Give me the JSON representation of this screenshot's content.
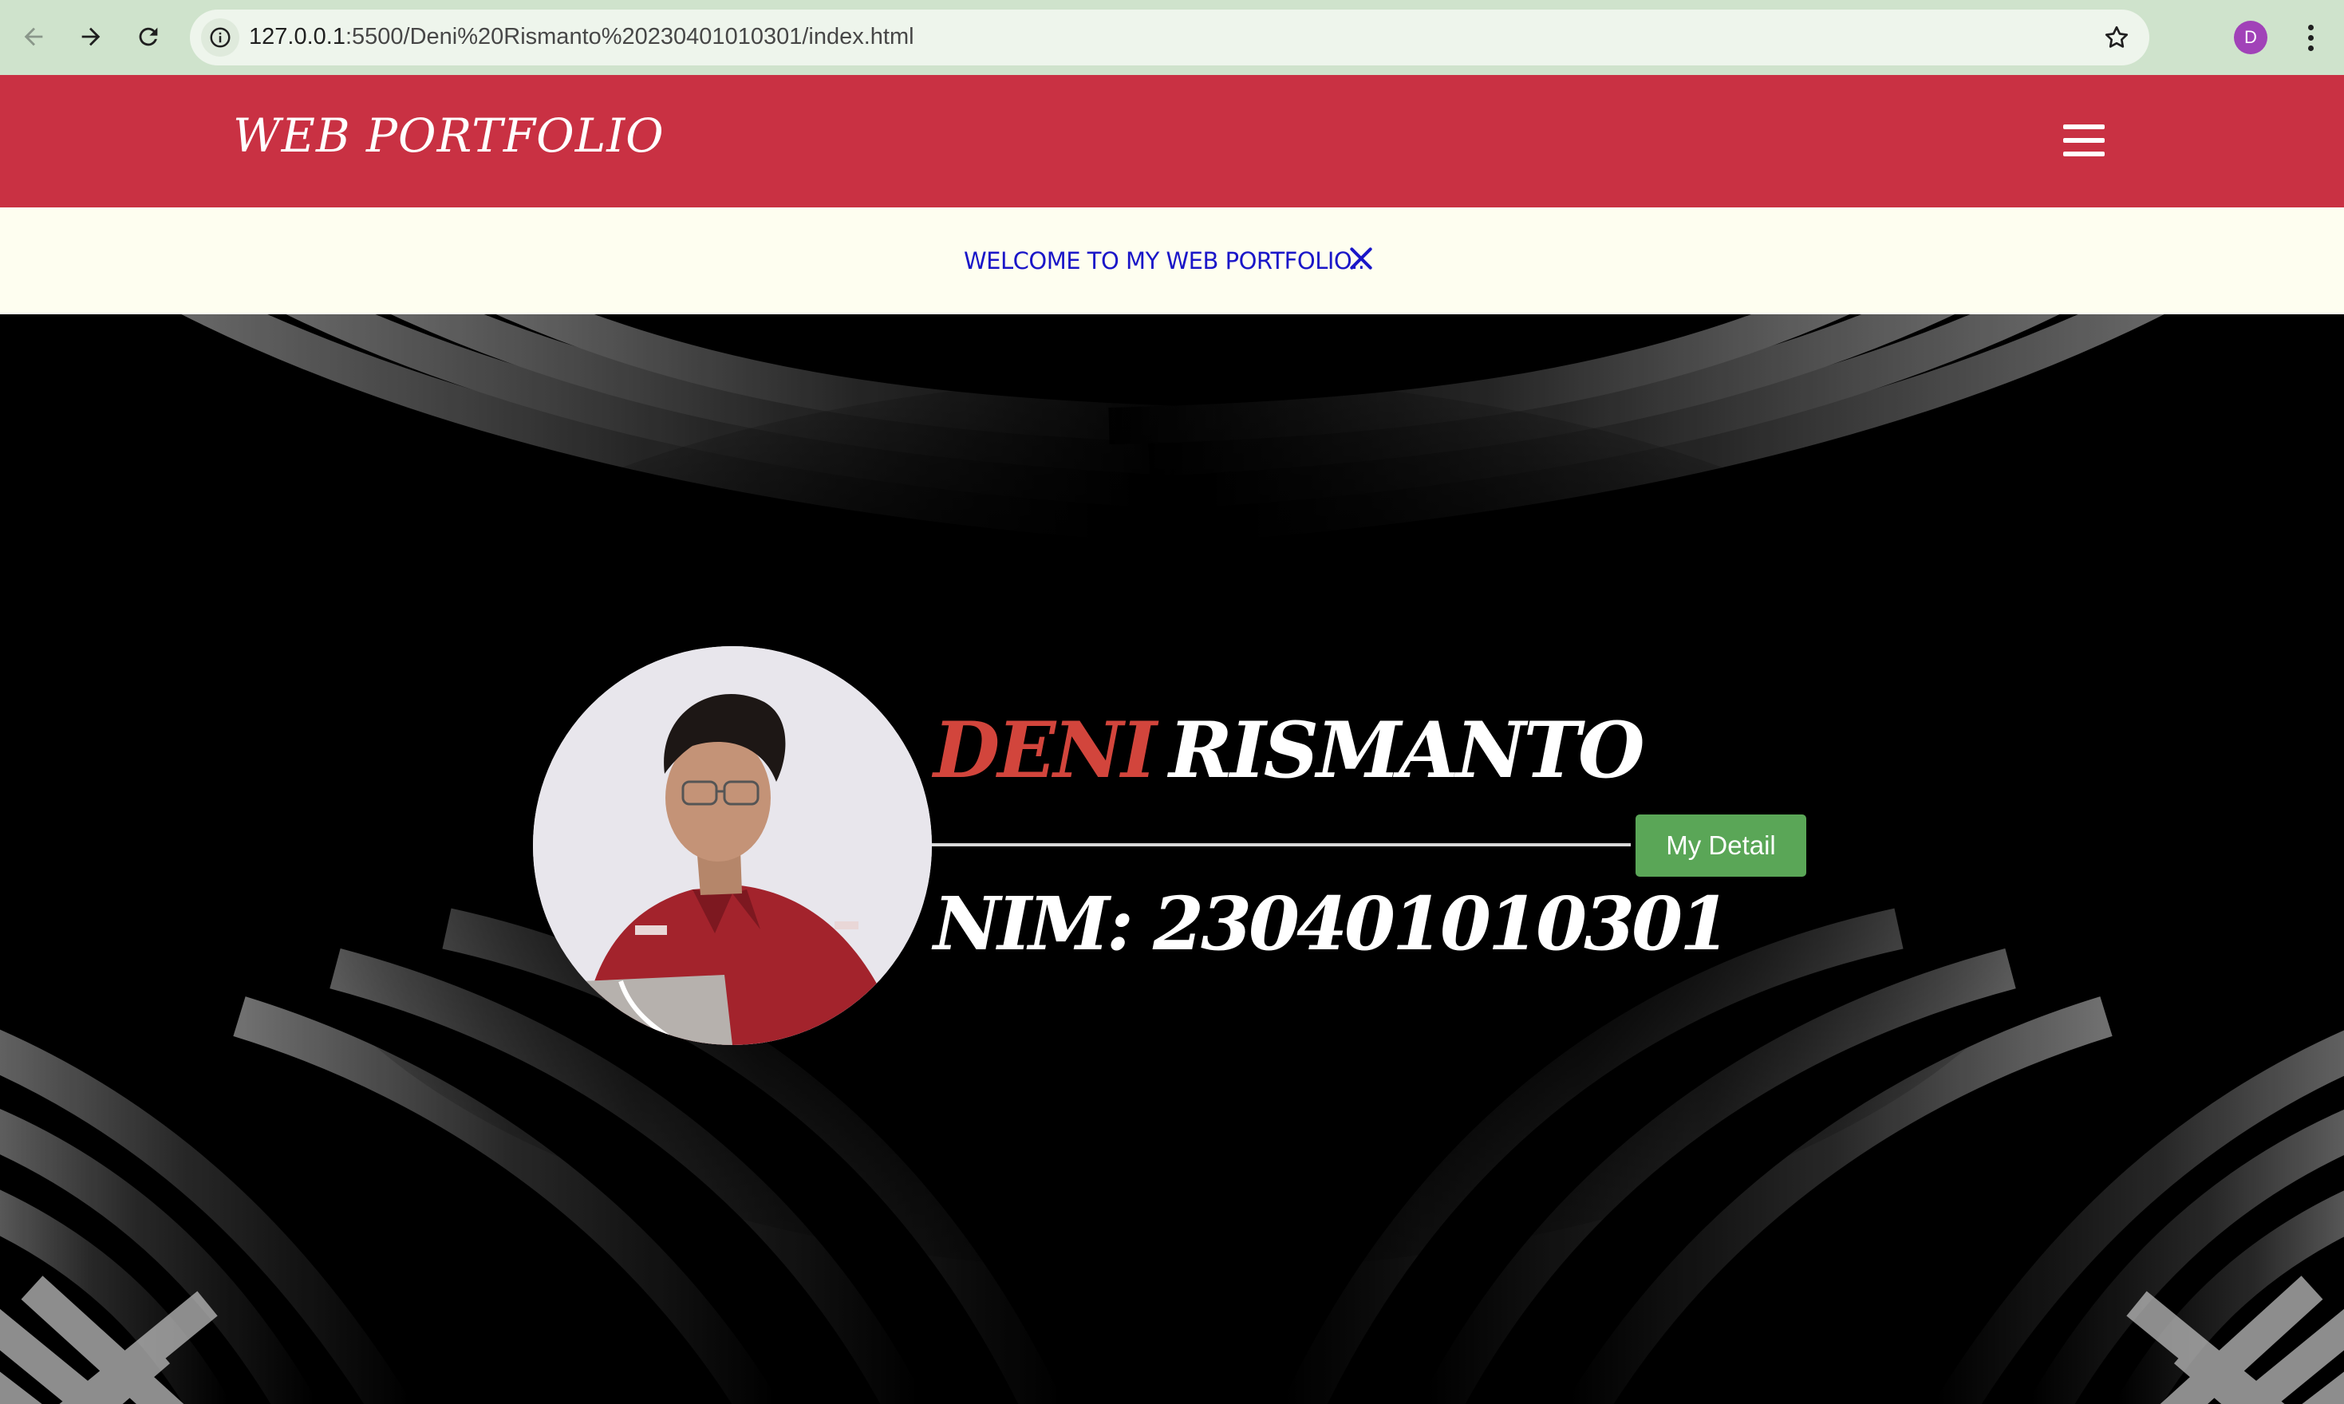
{
  "browser": {
    "url_host": "127.0.0.1",
    "url_path": ":5500/Deni%20Rismanto%20230401010301/index.html",
    "profile_initial": "D",
    "icons": [
      "back-icon",
      "forward-icon",
      "reload-icon",
      "site-info-icon",
      "bookmark-star-icon",
      "more-menu-icon"
    ]
  },
  "header": {
    "logo": "WEB PORTFOLIO",
    "menu_icon": "hamburger-menu-icon",
    "color": "#c93143"
  },
  "banner": {
    "text": "WELCOME TO MY WEB PORTFOLIO..",
    "close_icon": "close-icon",
    "text_color": "#1a16c8",
    "background": "#fefef0"
  },
  "hero": {
    "first_name": "DENI",
    "last_name": "RISMANTO",
    "button_label": "My Detail",
    "nim": "NIM: 230401010301",
    "accent_color": "#d2453c",
    "button_color": "#5aa657"
  }
}
